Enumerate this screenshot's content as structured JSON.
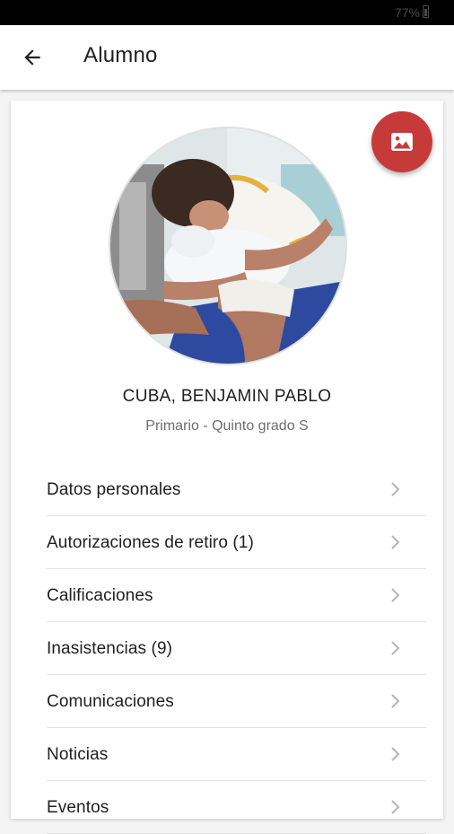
{
  "status_bar": {
    "battery": "77%"
  },
  "app_bar": {
    "title": "Alumno",
    "back_icon": "arrow-left-icon"
  },
  "fab": {
    "icon": "image-icon",
    "color": "#c73a3a"
  },
  "student": {
    "name": "CUBA, BENJAMIN PABLO",
    "grade": "Primario - Quinto grado S"
  },
  "menu": {
    "items": [
      {
        "label": "Datos personales"
      },
      {
        "label": "Autorizaciones de retiro (1)"
      },
      {
        "label": "Calificaciones"
      },
      {
        "label": "Inasistencias (9)"
      },
      {
        "label": "Comunicaciones"
      },
      {
        "label": "Noticias"
      },
      {
        "label": "Eventos"
      }
    ]
  }
}
